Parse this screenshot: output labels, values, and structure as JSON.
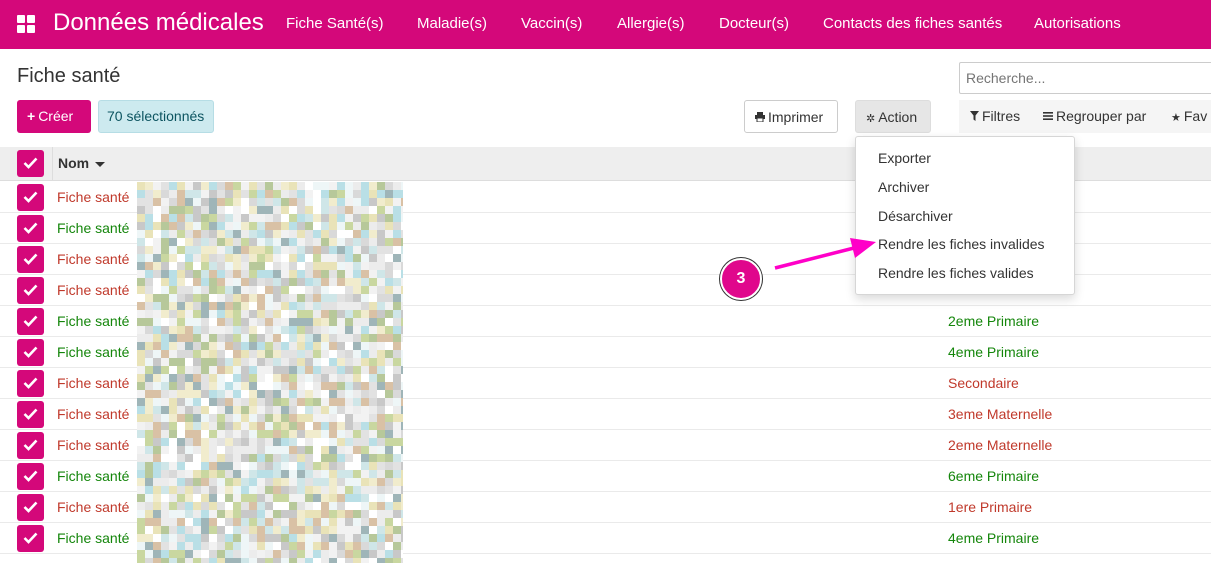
{
  "navbar": {
    "brand": "Données médicales",
    "menu": [
      "Fiche Santé(s)",
      "Maladie(s)",
      "Vaccin(s)",
      "Allergie(s)",
      "Docteur(s)",
      "Contacts des fiches santés",
      "Autorisations"
    ]
  },
  "control": {
    "title": "Fiche santé",
    "search_placeholder": "Recherche...",
    "create_label": "Créer",
    "selected_label": "70 sélectionnés",
    "print_label": "Imprimer",
    "action_label": "Action",
    "filters_label": "Filtres",
    "groupby_label": "Regrouper par",
    "favorites_label": "Fav"
  },
  "list": {
    "header_name": "Nom",
    "rows": [
      {
        "name": "Fiche santé",
        "class": "",
        "status": "red"
      },
      {
        "name": "Fiche santé",
        "class": "",
        "status": "green"
      },
      {
        "name": "Fiche santé",
        "class": "",
        "status": "red"
      },
      {
        "name": "Fiche santé",
        "class": "",
        "status": "red"
      },
      {
        "name": "Fiche santé",
        "class": "2eme Primaire",
        "status": "green"
      },
      {
        "name": "Fiche santé",
        "class": "4eme Primaire",
        "status": "green"
      },
      {
        "name": "Fiche santé",
        "class": "Secondaire",
        "status": "red"
      },
      {
        "name": "Fiche santé",
        "class": "3eme Maternelle",
        "status": "red"
      },
      {
        "name": "Fiche santé",
        "class": "2eme Maternelle",
        "status": "red"
      },
      {
        "name": "Fiche santé",
        "class": "6eme Primaire",
        "status": "green"
      },
      {
        "name": "Fiche santé",
        "class": "1ere Primaire",
        "status": "red"
      },
      {
        "name": "Fiche santé",
        "class": "4eme Primaire",
        "status": "green"
      }
    ]
  },
  "action_menu": {
    "items": [
      "Exporter",
      "Archiver",
      "Désarchiver",
      "Rendre les fiches invalides",
      "Rendre les fiches valides"
    ]
  },
  "annotation": {
    "step": "3"
  },
  "colors": {
    "brand": "#d4087a",
    "invalid": "#c0392b",
    "valid": "#14860b",
    "annotation": "#ff00c8"
  },
  "icons": {
    "apps": "apps-grid-icon",
    "print": "printer-icon",
    "action": "gear-icon",
    "filters": "filter-icon",
    "groupby": "bars-icon",
    "favorites": "star-icon",
    "check": "check-icon"
  }
}
